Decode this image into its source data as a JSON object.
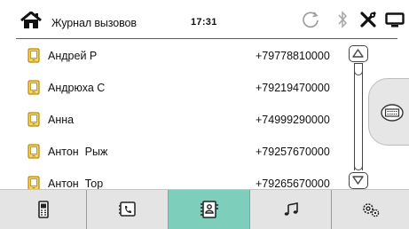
{
  "header": {
    "title": "Журнал вызовов",
    "time": "17:31",
    "accent_line_color": "#c9302c"
  },
  "contacts": [
    {
      "name": "Андрей Р",
      "number": "+79778810000"
    },
    {
      "name": "Андрюха С",
      "number": "+79219470000"
    },
    {
      "name": "Анна",
      "number": "+74999290000"
    },
    {
      "name": "Антон  Рыж",
      "number": "+79257670000"
    },
    {
      "name": "Антон  Тор",
      "number": "+79265670000"
    }
  ],
  "icons": {
    "header": [
      "home-icon",
      "sync-icon",
      "bluetooth-icon",
      "settings-tools-icon",
      "screen-icon"
    ],
    "contact_row": "mobile-phone-icon",
    "side_panel": "keyboard-icon",
    "nav": [
      "phone-device-icon",
      "call-log-icon",
      "contacts-icon",
      "music-icon",
      "settings-gear-icon"
    ]
  },
  "nav": {
    "active_index": 2,
    "active_color": "#7dcfbc",
    "background_color": "#e4e4e4"
  },
  "contact_icon_color": "#e0b400"
}
